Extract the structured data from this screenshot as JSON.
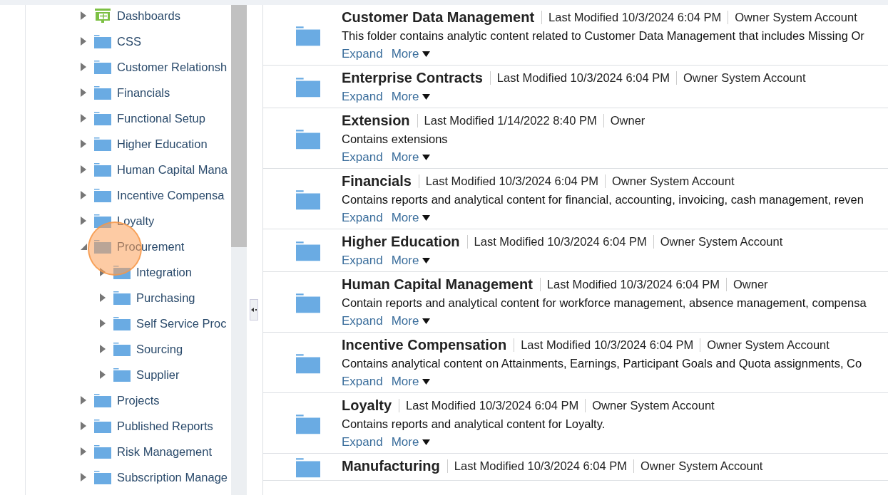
{
  "tree": [
    {
      "label": "Dashboards",
      "kind": "dashboard",
      "expanded": false
    },
    {
      "label": "CSS",
      "kind": "folder",
      "expanded": false
    },
    {
      "label": "Customer Relationsh",
      "kind": "folder",
      "expanded": false
    },
    {
      "label": "Financials",
      "kind": "folder",
      "expanded": false
    },
    {
      "label": "Functional Setup",
      "kind": "folder",
      "expanded": false
    },
    {
      "label": "Higher Education",
      "kind": "folder",
      "expanded": false
    },
    {
      "label": "Human Capital Mana",
      "kind": "folder",
      "expanded": false
    },
    {
      "label": "Incentive Compensa",
      "kind": "folder",
      "expanded": false
    },
    {
      "label": "Loyalty",
      "kind": "folder",
      "expanded": false
    },
    {
      "label": "Procurement",
      "kind": "folder",
      "expanded": true,
      "children": [
        {
          "label": "Integration",
          "kind": "folder",
          "expanded": false
        },
        {
          "label": "Purchasing",
          "kind": "folder",
          "expanded": false
        },
        {
          "label": "Self Service Proc",
          "kind": "folder",
          "expanded": false
        },
        {
          "label": "Sourcing",
          "kind": "folder",
          "expanded": false
        },
        {
          "label": "Supplier",
          "kind": "folder",
          "expanded": false
        }
      ]
    },
    {
      "label": "Projects",
      "kind": "folder",
      "expanded": false
    },
    {
      "label": "Published Reports",
      "kind": "folder",
      "expanded": false
    },
    {
      "label": "Risk Management",
      "kind": "folder",
      "expanded": false
    },
    {
      "label": "Subscription Manage",
      "kind": "folder",
      "expanded": false
    }
  ],
  "catalog": [
    {
      "title": "Customer Data Management",
      "modified": "Last Modified 10/3/2024 6:04 PM",
      "owner": "Owner System Account",
      "description": "This folder contains analytic content related to Customer Data Management that includes Missing Or",
      "expand": "Expand",
      "more": "More"
    },
    {
      "title": "Enterprise Contracts",
      "modified": "Last Modified 10/3/2024 6:04 PM",
      "owner": "Owner System Account",
      "expand": "Expand",
      "more": "More"
    },
    {
      "title": "Extension",
      "modified": "Last Modified 1/14/2022 8:40 PM",
      "owner": "Owner",
      "description": "Contains extensions",
      "expand": "Expand",
      "more": "More"
    },
    {
      "title": "Financials",
      "modified": "Last Modified 10/3/2024 6:04 PM",
      "owner": "Owner System Account",
      "description": "Contains reports and analytical content for financial, accounting, invoicing, cash management, reven",
      "expand": "Expand",
      "more": "More"
    },
    {
      "title": "Higher Education",
      "modified": "Last Modified 10/3/2024 6:04 PM",
      "owner": "Owner System Account",
      "expand": "Expand",
      "more": "More"
    },
    {
      "title": "Human Capital Management",
      "modified": "Last Modified 10/3/2024 6:04 PM",
      "owner": "Owner",
      "description": "Contain reports and analytical content for workforce management, absence management, compensa",
      "expand": "Expand",
      "more": "More"
    },
    {
      "title": "Incentive Compensation",
      "modified": "Last Modified 10/3/2024 6:04 PM",
      "owner": "Owner System Account",
      "description": "Contains analytical content on Attainments, Earnings, Participant Goals and Quota assignments, Co",
      "expand": "Expand",
      "more": "More"
    },
    {
      "title": "Loyalty",
      "modified": "Last Modified 10/3/2024 6:04 PM",
      "owner": "Owner System Account",
      "description": "Contains reports and analytical content for Loyalty.",
      "expand": "Expand",
      "more": "More"
    },
    {
      "title": "Manufacturing",
      "modified": "Last Modified 10/3/2024 6:04 PM",
      "owner": "Owner System Account"
    }
  ]
}
